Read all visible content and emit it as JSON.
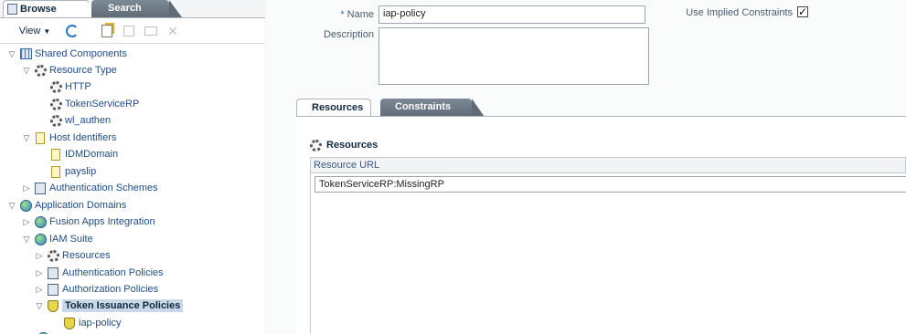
{
  "left_tabs": {
    "browse": "Browse",
    "search": "Search"
  },
  "toolbar": {
    "view_label": "View"
  },
  "tree": [
    {
      "label": "Shared Components",
      "icon": "grid-icon",
      "toggle": "▽",
      "selected": false
    },
    {
      "label": "Resource Type",
      "icon": "gear-icon",
      "toggle": "▽",
      "selected": false
    },
    {
      "label": "HTTP",
      "icon": "gear-icon",
      "toggle": "",
      "selected": false
    },
    {
      "label": "TokenServiceRP",
      "icon": "gear-icon",
      "toggle": "",
      "selected": false
    },
    {
      "label": "wl_authen",
      "icon": "gear-icon",
      "toggle": "",
      "selected": false
    },
    {
      "label": "Host Identifiers",
      "icon": "document-icon",
      "toggle": "▽",
      "selected": false
    },
    {
      "label": "IDMDomain",
      "icon": "document-icon",
      "toggle": "",
      "selected": false
    },
    {
      "label": "payslip",
      "icon": "document-icon",
      "toggle": "",
      "selected": false
    },
    {
      "label": "Authentication Schemes",
      "icon": "policy-icon",
      "toggle": "▷",
      "selected": false
    },
    {
      "label": "Application Domains",
      "icon": "globe-icon",
      "toggle": "▽",
      "selected": false
    },
    {
      "label": "Fusion Apps Integration",
      "icon": "globe-icon",
      "toggle": "▷",
      "selected": false
    },
    {
      "label": "IAM Suite",
      "icon": "globe-icon",
      "toggle": "▽",
      "selected": false
    },
    {
      "label": "Resources",
      "icon": "gear-icon",
      "toggle": "▷",
      "selected": false
    },
    {
      "label": "Authentication Policies",
      "icon": "policy-icon",
      "toggle": "▷",
      "selected": false
    },
    {
      "label": "Authorization Policies",
      "icon": "policy-icon",
      "toggle": "▷",
      "selected": false
    },
    {
      "label": "Token Issuance Policies",
      "icon": "shield-icon",
      "toggle": "▽",
      "selected": true
    },
    {
      "label": "iap-policy",
      "icon": "shield-icon",
      "toggle": "",
      "selected": false
    }
  ],
  "form": {
    "name_label": "Name",
    "name_required_mark": "*",
    "name_value": "iap-policy",
    "description_label": "Description",
    "description_value": "",
    "implied_label": "Use Implied Constraints",
    "implied_checked": "✓"
  },
  "detail_tabs": {
    "resources": "Resources",
    "constraints": "Constraints"
  },
  "resources_panel": {
    "title": "Resources",
    "column_header": "Resource URL",
    "rows": [
      "TokenServiceRP:MissingRP"
    ]
  }
}
